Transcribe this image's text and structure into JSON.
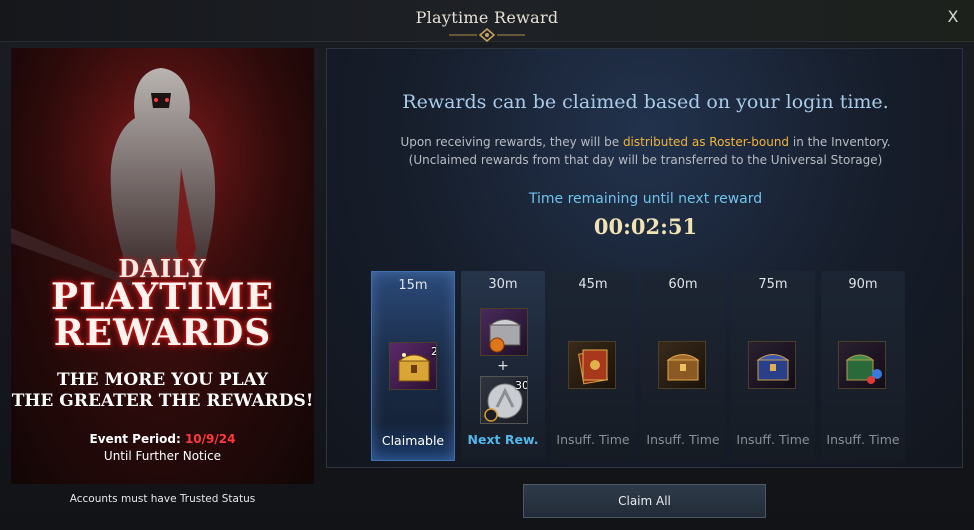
{
  "window": {
    "title": "Playtime Reward",
    "close_label": "X"
  },
  "banner": {
    "daily": "DAILY",
    "playtime": "PLAYTIME",
    "rewards": "REWARDS",
    "tagline_1": "THE MORE YOU PLAY",
    "tagline_2": "THE GREATER THE REWARDS!",
    "event_period_label": "Event Period:",
    "event_period_date": "10/9/24",
    "event_until": "Until Further Notice",
    "trusted_note": "Accounts must have Trusted Status"
  },
  "panel": {
    "headline": "Rewards can be claimed based on your login time.",
    "subline_1_pre": "Upon receiving rewards, they will be ",
    "subline_1_highlight": "distributed as Roster-bound",
    "subline_1_post": " in the Inventory.",
    "subline_2": "(Unclaimed rewards from that day will be transferred to the Universal Storage)",
    "remaining_label": "Time remaining until next reward",
    "timer": "00:02:51"
  },
  "slots": [
    {
      "time": "15m",
      "status": "Claimable",
      "state": "claimable",
      "items": [
        {
          "icon": "gold-chest-icon",
          "qty": "2"
        }
      ]
    },
    {
      "time": "30m",
      "status": "Next Rew.",
      "state": "next",
      "items": [
        {
          "icon": "silver-chest-icon",
          "qty": ""
        },
        {
          "icon": "silver-coin-icon",
          "qty": "30"
        }
      ]
    },
    {
      "time": "45m",
      "status": "Insuff. Time",
      "state": "locked",
      "items": [
        {
          "icon": "card-pack-icon",
          "qty": ""
        }
      ]
    },
    {
      "time": "60m",
      "status": "Insuff. Time",
      "state": "locked",
      "items": [
        {
          "icon": "bronze-chest-icon",
          "qty": ""
        }
      ]
    },
    {
      "time": "75m",
      "status": "Insuff. Time",
      "state": "locked",
      "items": [
        {
          "icon": "blue-chest-icon",
          "qty": ""
        }
      ]
    },
    {
      "time": "90m",
      "status": "Insuff. Time",
      "state": "locked",
      "items": [
        {
          "icon": "green-chest-icon",
          "qty": ""
        }
      ]
    }
  ],
  "claim_all_label": "Claim All",
  "colors": {
    "highlight": "#f0b43c",
    "accent_blue": "#6ec3ea",
    "event_date": "#ff3a3a"
  }
}
